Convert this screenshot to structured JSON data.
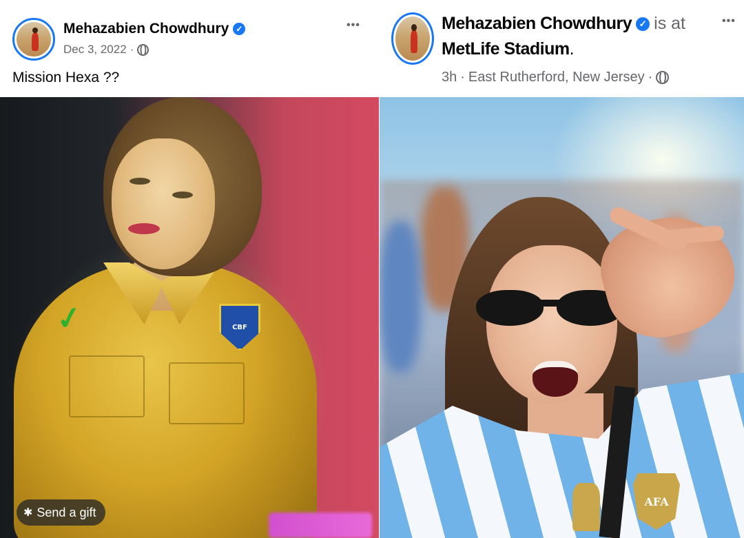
{
  "posts": [
    {
      "author": "Mehazabien Chowdhury",
      "verified": true,
      "location_prefix": "",
      "location_name": "",
      "timestamp": "Dec 3, 2022",
      "audience_icon": "globe-icon",
      "caption": "Mission Hexa ??",
      "more_icon": "more-options-icon",
      "send_gift_label": "Send a gift",
      "send_gift_icon": "gift-icon",
      "jersey_badge_text": "CBF"
    },
    {
      "author": "Mehazabien Chowdhury",
      "verified": true,
      "location_prefix": "is at",
      "location_name": "MetLife Stadium",
      "location_suffix": ".",
      "timestamp": "3h",
      "place": "East Rutherford, New Jersey",
      "audience_icon": "globe-icon",
      "more_icon": "more-options-icon",
      "jersey_badge_text": "AFA"
    }
  ],
  "ui": {
    "separator": "·",
    "more_glyph": "•••",
    "verified_glyph": "✓"
  },
  "colors": {
    "accent": "#1877f2",
    "meta_text": "#65676b",
    "text": "#050505"
  }
}
